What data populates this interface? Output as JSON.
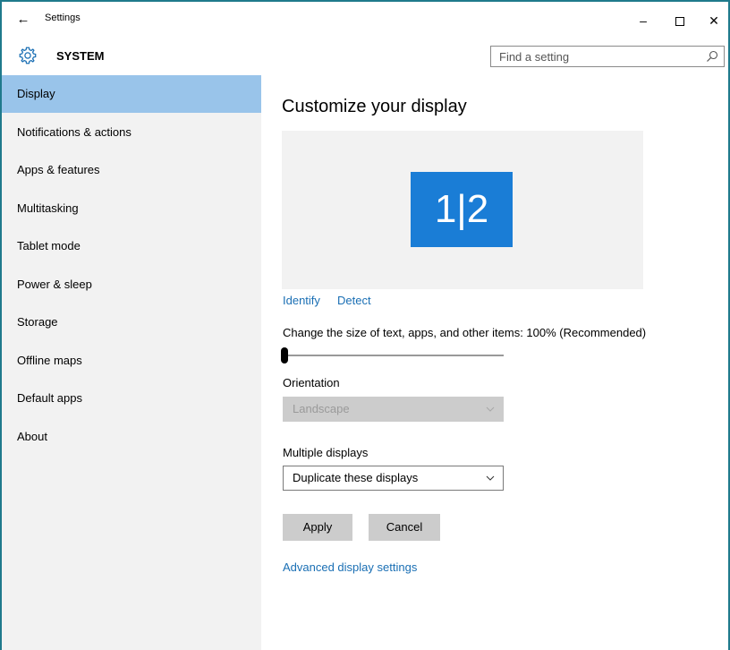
{
  "window": {
    "title": "Settings",
    "back_icon": "back-arrow-icon",
    "minimize_glyph": "–",
    "close_glyph": "✕"
  },
  "header": {
    "section_title": "SYSTEM",
    "section_icon": "gear-icon",
    "search_placeholder": "Find a setting",
    "search_value": ""
  },
  "sidebar": {
    "items": [
      {
        "label": "Display",
        "active": true
      },
      {
        "label": "Notifications & actions",
        "active": false
      },
      {
        "label": "Apps & features",
        "active": false
      },
      {
        "label": "Multitasking",
        "active": false
      },
      {
        "label": "Tablet mode",
        "active": false
      },
      {
        "label": "Power & sleep",
        "active": false
      },
      {
        "label": "Storage",
        "active": false
      },
      {
        "label": "Offline maps",
        "active": false
      },
      {
        "label": "Default apps",
        "active": false
      },
      {
        "label": "About",
        "active": false
      }
    ]
  },
  "main": {
    "title": "Customize your display",
    "monitor_label": "1|2",
    "identify_label": "Identify",
    "detect_label": "Detect",
    "scale_label": "Change the size of text, apps, and other items: 100% (Recommended)",
    "scale_value_fraction": 0.0,
    "orientation_label": "Orientation",
    "orientation_value": "Landscape",
    "orientation_disabled": true,
    "multiple_displays_label": "Multiple displays",
    "multiple_displays_value": "Duplicate these displays",
    "apply_label": "Apply",
    "cancel_label": "Cancel",
    "advanced_link": "Advanced display settings"
  },
  "colors": {
    "accent": "#1a7dd6",
    "sidebar_active": "#99c4ea",
    "link": "#1a6fb4",
    "window_border": "#1f7a8c"
  }
}
